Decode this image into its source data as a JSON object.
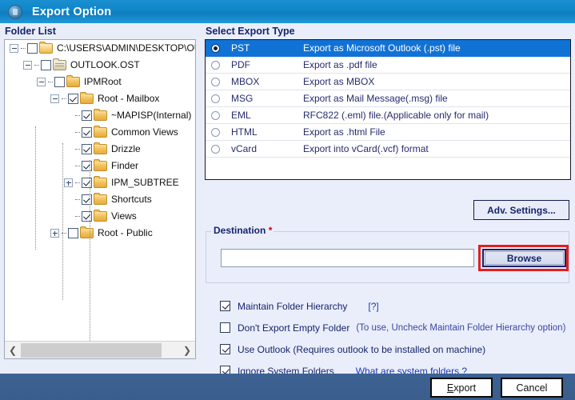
{
  "window": {
    "title": "Export Option",
    "icon": "app-shield-icon"
  },
  "colors": {
    "titlebar": "#1186c9",
    "accent_selected": "#1172d6",
    "label_navy": "#16246b",
    "highlight_red": "#e02020",
    "link_blue": "#1a39b8",
    "footer": "#3a5d8c"
  },
  "folder_list": {
    "header": "Folder List",
    "nodes": [
      {
        "label": "C:\\USERS\\ADMIN\\DESKTOP\\OUTL(",
        "depth": 0,
        "expander": "minus",
        "checked": false,
        "icon": "folder-open-icon"
      },
      {
        "label": "OUTLOOK.OST",
        "depth": 1,
        "expander": "minus",
        "checked": false,
        "icon": "ost-stack-icon"
      },
      {
        "label": "IPMRoot",
        "depth": 2,
        "expander": "minus",
        "checked": false,
        "icon": "folder-icon"
      },
      {
        "label": "Root - Mailbox",
        "depth": 3,
        "expander": "minus",
        "checked": true,
        "icon": "folder-icon"
      },
      {
        "label": "~MAPISP(Internal)",
        "depth": 4,
        "expander": "none",
        "checked": true,
        "icon": "folder-icon"
      },
      {
        "label": "Common Views",
        "depth": 4,
        "expander": "none",
        "checked": true,
        "icon": "folder-icon"
      },
      {
        "label": "Drizzle",
        "depth": 4,
        "expander": "none",
        "checked": true,
        "icon": "folder-icon"
      },
      {
        "label": "Finder",
        "depth": 4,
        "expander": "none",
        "checked": true,
        "icon": "folder-icon"
      },
      {
        "label": "IPM_SUBTREE",
        "depth": 4,
        "expander": "plus",
        "checked": true,
        "icon": "folder-icon"
      },
      {
        "label": "Shortcuts",
        "depth": 4,
        "expander": "none",
        "checked": true,
        "icon": "folder-icon"
      },
      {
        "label": "Views",
        "depth": 4,
        "expander": "none",
        "checked": true,
        "icon": "folder-icon"
      },
      {
        "label": "Root - Public",
        "depth": 3,
        "expander": "plus",
        "checked": false,
        "icon": "folder-icon"
      }
    ],
    "scrollbar": {
      "left_arrow": "❮",
      "right_arrow": "❯"
    }
  },
  "export_type": {
    "header": "Select Export Type",
    "selected": "PST",
    "rows": [
      {
        "name": "PST",
        "desc": "Export as Microsoft Outlook (.pst) file",
        "selected": true
      },
      {
        "name": "PDF",
        "desc": "Export as .pdf file",
        "selected": false
      },
      {
        "name": "MBOX",
        "desc": "Export as MBOX",
        "selected": false
      },
      {
        "name": "MSG",
        "desc": "Export as Mail Message(.msg) file",
        "selected": false
      },
      {
        "name": "EML",
        "desc": "RFC822 (.eml) file.(Applicable only for mail)",
        "selected": false
      },
      {
        "name": "HTML",
        "desc": "Export as .html File",
        "selected": false
      },
      {
        "name": "vCard",
        "desc": "Export into vCard(.vcf) format",
        "selected": false
      }
    ]
  },
  "adv_settings": {
    "label": "Adv. Settings..."
  },
  "destination": {
    "legend": "Destination",
    "required_mark": "*",
    "value": "",
    "placeholder": "",
    "browse_label": "Browse"
  },
  "options": [
    {
      "label": "Maintain Folder Hierarchy",
      "checked": true,
      "note": "",
      "link": "[?]"
    },
    {
      "label": "Don't Export Empty Folder",
      "checked": false,
      "note": "(To use, Uncheck Maintain Folder Hierarchy option)",
      "link": ""
    },
    {
      "label": "Use Outlook (Requires outlook to be installed on machine)",
      "checked": true,
      "note": "",
      "link": ""
    },
    {
      "label": "Ignore System Folders",
      "checked": true,
      "note": "",
      "link": "What are system folders ?"
    }
  ],
  "footer": {
    "export_label": "Export",
    "export_accel": "E",
    "export_rest": "xport",
    "cancel_label": "Cancel"
  }
}
